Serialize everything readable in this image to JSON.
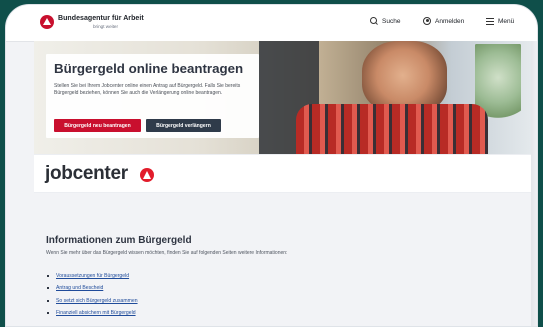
{
  "header": {
    "brand": "Bundesagentur für Arbeit",
    "tagline": "bringt weiter",
    "search": "Suche",
    "login": "Anmelden",
    "menu": "Menü",
    "icons": [
      "ba-logo-icon",
      "search-icon",
      "user-icon",
      "menu-icon"
    ]
  },
  "hero": {
    "title": "Bürgergeld online beantragen",
    "text": "Stellen Sie bei Ihrem Jobcenter online einen Antrag auf Bürgergeld. Falls Sie bereits Bürgergeld beziehen, können Sie auch die Verlängerung online beantragen.",
    "buttons": {
      "primary": "Bürgergeld neu beantragen",
      "secondary": "Bürgergeld verlängern"
    }
  },
  "jobcenter": {
    "name": "jobcenter",
    "icon": "jobcenter-logo-icon"
  },
  "info": {
    "title": "Informationen zum Bürgergeld",
    "text": "Wenn Sie mehr über das Bürgergeld wissen möchten, finden Sie auf folgenden Seiten weitere Informationen:",
    "links": [
      "Voraussetzungen für Bürgergeld",
      "Antrag und Bescheid",
      "So setzt sich Bürgergeld zusammen",
      "Finanziell absichern mit Bürgergeld"
    ]
  },
  "colors": {
    "frame": "#0f4f4a",
    "brand_red": "#c90f2e",
    "dark_button": "#2f3b4a",
    "link": "#1f4b9a"
  }
}
